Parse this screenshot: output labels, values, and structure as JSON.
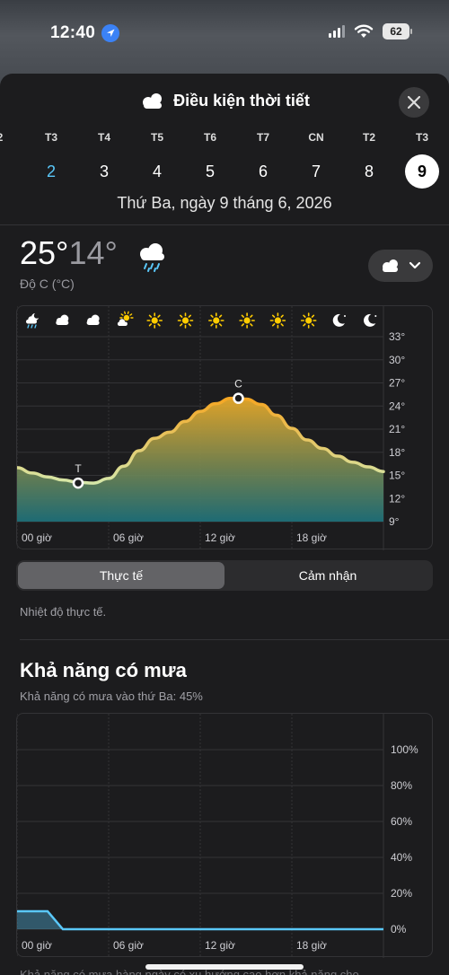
{
  "status": {
    "time": "12:40",
    "battery": "62"
  },
  "sheet": {
    "title": "Điều kiện thời tiết"
  },
  "days": [
    {
      "dow": "",
      "num": "",
      "cut": "2"
    },
    {
      "dow": "T3",
      "num": "2",
      "style": "blue"
    },
    {
      "dow": "T4",
      "num": "3"
    },
    {
      "dow": "T5",
      "num": "4"
    },
    {
      "dow": "T6",
      "num": "5"
    },
    {
      "dow": "T7",
      "num": "6"
    },
    {
      "dow": "CN",
      "num": "7"
    },
    {
      "dow": "T2",
      "num": "8"
    },
    {
      "dow": "T3",
      "num": "9",
      "style": "selected"
    }
  ],
  "date_line": "Thứ Ba, ngày 9 tháng 6, 2026",
  "temp": {
    "high": "25°",
    "low": "14°",
    "unit": "Độ C (°C)"
  },
  "segmented": {
    "actual": "Thực tế",
    "feels": "Cảm nhận"
  },
  "note": "Nhiệt độ thực tế.",
  "rain": {
    "title": "Khả năng có mưa",
    "subtitle": "Khả năng có mưa vào thứ Ba: 45%",
    "bottom_text": "Khả năng có mưa hàng ngày có xu hướng cao hơn khả năng cho"
  },
  "hour_icons": [
    "cloud-moon-rain-icon",
    "cloud-icon",
    "cloud-icon",
    "cloud-sun-icon",
    "sun-icon",
    "sun-icon",
    "sun-icon",
    "sun-icon",
    "sun-icon",
    "sun-icon",
    "moon-stars-icon",
    "moon-stars-icon"
  ],
  "chart_data": [
    {
      "type": "area",
      "title": "",
      "x_labels": [
        "00 giờ",
        "06 giờ",
        "12 giờ",
        "18 giờ"
      ],
      "y_ticks": [
        "33°",
        "30°",
        "27°",
        "24°",
        "21°",
        "18°",
        "15°",
        "12°",
        "9°"
      ],
      "ylim": [
        9,
        33
      ],
      "x": [
        0,
        1,
        2,
        3,
        4,
        5,
        6,
        7,
        8,
        9,
        10,
        11,
        12,
        13,
        14,
        15,
        16,
        17,
        18,
        19,
        20,
        21,
        22,
        23,
        24
      ],
      "values": [
        16,
        15.3,
        14.8,
        14.4,
        14.1,
        14,
        14.6,
        16.2,
        18.2,
        19.8,
        20.6,
        22,
        23.3,
        24.3,
        25,
        24.9,
        24.2,
        22.8,
        21.1,
        19.6,
        18.5,
        17.5,
        16.7,
        16.1,
        15.5
      ],
      "annotations": [
        {
          "label": "T",
          "x": 4,
          "y": 14
        },
        {
          "label": "C",
          "x": 14.5,
          "y": 25
        }
      ],
      "grid": true
    },
    {
      "type": "area",
      "title": "",
      "x_labels": [
        "00 giờ",
        "06 giờ",
        "12 giờ",
        "18 giờ"
      ],
      "y_ticks": [
        "100%",
        "80%",
        "60%",
        "40%",
        "20%",
        "0%"
      ],
      "ylim": [
        0,
        100
      ],
      "x": [
        0,
        1,
        2,
        3,
        4,
        24
      ],
      "values": [
        10,
        10,
        10,
        0,
        0,
        0
      ],
      "grid": true
    }
  ]
}
